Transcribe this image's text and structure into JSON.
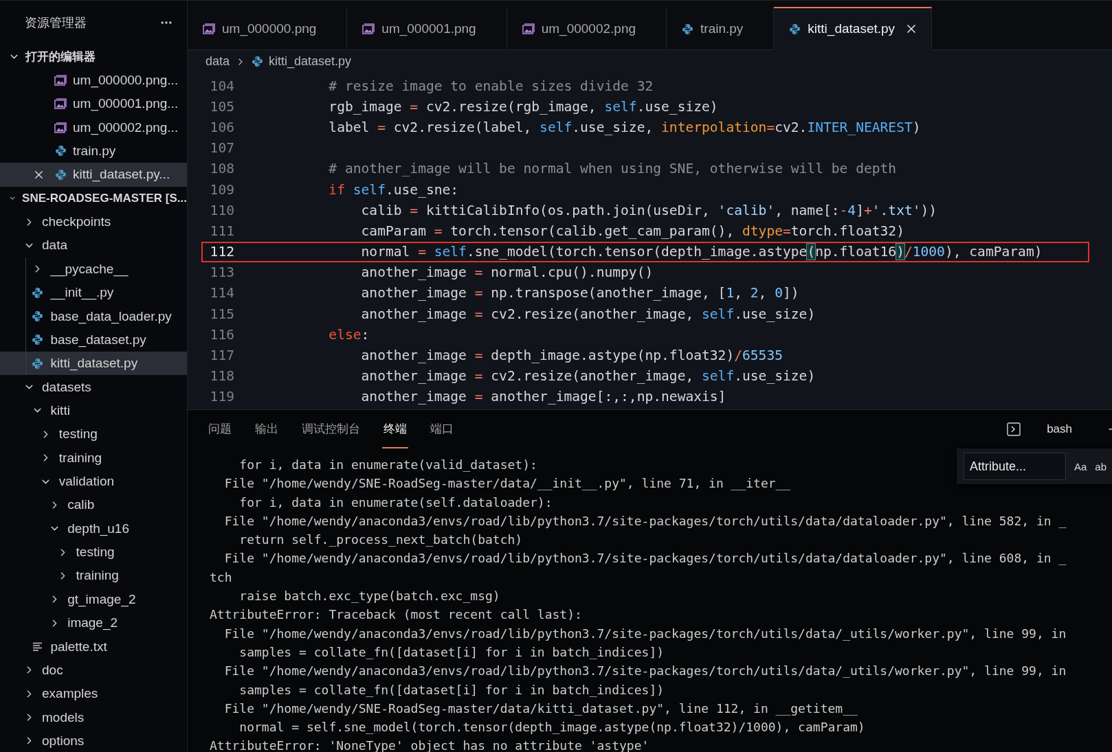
{
  "sidebar": {
    "title": "资源管理器",
    "open_editors": {
      "title": "打开的编辑器",
      "expanded": true,
      "items": [
        {
          "name": "um_000000.png...",
          "kind": "image",
          "selected": false
        },
        {
          "name": "um_000001.png...",
          "kind": "image",
          "selected": false
        },
        {
          "name": "um_000002.png...",
          "kind": "image",
          "selected": false
        },
        {
          "name": "train.py",
          "kind": "python",
          "selected": false
        },
        {
          "name": "kitti_dataset.py...",
          "kind": "python",
          "selected": true
        }
      ]
    },
    "project": {
      "title": "SNE-ROADSEG-MASTER [S...",
      "expanded": true,
      "tree": [
        {
          "label": "checkpoints",
          "kind": "folder",
          "expanded": false,
          "selected": false
        },
        {
          "label": "data",
          "kind": "folder",
          "expanded": true,
          "selected": false,
          "children": [
            {
              "label": "__pycache__",
              "kind": "folder",
              "expanded": false,
              "selected": false
            },
            {
              "label": "__init__.py",
              "kind": "python",
              "selected": false
            },
            {
              "label": "base_data_loader.py",
              "kind": "python",
              "selected": false
            },
            {
              "label": "base_dataset.py",
              "kind": "python",
              "selected": false
            },
            {
              "label": "kitti_dataset.py",
              "kind": "python",
              "selected": true
            }
          ]
        },
        {
          "label": "datasets",
          "kind": "folder",
          "expanded": true,
          "selected": false,
          "children": [
            {
              "label": "kitti",
              "kind": "folder",
              "expanded": true,
              "selected": false,
              "children": [
                {
                  "label": "testing",
                  "kind": "folder",
                  "expanded": false,
                  "selected": false
                },
                {
                  "label": "training",
                  "kind": "folder",
                  "expanded": false,
                  "selected": false
                },
                {
                  "label": "validation",
                  "kind": "folder",
                  "expanded": true,
                  "selected": false,
                  "children": [
                    {
                      "label": "calib",
                      "kind": "folder",
                      "expanded": false,
                      "selected": false
                    },
                    {
                      "label": "depth_u16",
                      "kind": "folder",
                      "expanded": true,
                      "selected": false,
                      "children": [
                        {
                          "label": "testing",
                          "kind": "folder",
                          "expanded": false,
                          "selected": false
                        },
                        {
                          "label": "training",
                          "kind": "folder",
                          "expanded": false,
                          "selected": false
                        }
                      ]
                    },
                    {
                      "label": "gt_image_2",
                      "kind": "folder",
                      "expanded": false,
                      "selected": false
                    },
                    {
                      "label": "image_2",
                      "kind": "folder",
                      "expanded": false,
                      "selected": false
                    }
                  ]
                }
              ]
            },
            {
              "label": "palette.txt",
              "kind": "text",
              "selected": false
            }
          ]
        },
        {
          "label": "doc",
          "kind": "folder",
          "expanded": false,
          "selected": false
        },
        {
          "label": "examples",
          "kind": "folder",
          "expanded": false,
          "selected": false
        },
        {
          "label": "models",
          "kind": "folder",
          "expanded": false,
          "selected": false
        },
        {
          "label": "options",
          "kind": "folder",
          "expanded": false,
          "selected": false
        }
      ]
    }
  },
  "tabs": [
    {
      "label": "um_000000.png",
      "kind": "image",
      "selected": false
    },
    {
      "label": "um_000001.png",
      "kind": "image",
      "selected": false
    },
    {
      "label": "um_000002.png",
      "kind": "image",
      "selected": false
    },
    {
      "label": "train.py",
      "kind": "python",
      "selected": false
    },
    {
      "label": "kitti_dataset.py",
      "kind": "python",
      "selected": true
    }
  ],
  "breadcrumb": [
    {
      "label": "data",
      "kind": "folder"
    },
    {
      "label": "kitti_dataset.py",
      "kind": "python"
    }
  ],
  "editor": {
    "lines": [
      {
        "number": "104",
        "current": false,
        "tokens": [
          {
            "kind": "comment",
            "text": "        # resize image to enable sizes divide 32"
          }
        ]
      },
      {
        "number": "105",
        "current": false,
        "tokens": [
          {
            "kind": "plain",
            "text": "        rgb_image "
          },
          {
            "kind": "op",
            "text": "="
          },
          {
            "kind": "plain",
            "text": " cv2.resize(rgb_image, "
          },
          {
            "kind": "self",
            "text": "self"
          },
          {
            "kind": "plain",
            "text": ".use_size)"
          }
        ]
      },
      {
        "number": "106",
        "current": false,
        "tokens": [
          {
            "kind": "plain",
            "text": "        label "
          },
          {
            "kind": "op",
            "text": "="
          },
          {
            "kind": "plain",
            "text": " cv2.resize(label, "
          },
          {
            "kind": "self",
            "text": "self"
          },
          {
            "kind": "plain",
            "text": ".use_size, "
          },
          {
            "kind": "kwarg",
            "text": "interpolation"
          },
          {
            "kind": "op",
            "text": "="
          },
          {
            "kind": "plain",
            "text": "cv2."
          },
          {
            "kind": "const",
            "text": "INTER_NEAREST"
          },
          {
            "kind": "plain",
            "text": ")"
          }
        ]
      },
      {
        "number": "107",
        "current": false
      },
      {
        "number": "108",
        "current": false,
        "tokens": [
          {
            "kind": "comment",
            "text": "        # another_image will be normal when using SNE, otherwise will be depth"
          }
        ]
      },
      {
        "number": "109",
        "current": false,
        "tokens": [
          {
            "kind": "keyword",
            "text": "        if"
          },
          {
            "kind": "self",
            "text": " self"
          },
          {
            "kind": "plain",
            "text": ".use_sne:"
          }
        ]
      },
      {
        "number": "110",
        "current": false,
        "tokens": [
          {
            "kind": "plain",
            "text": "            calib "
          },
          {
            "kind": "op",
            "text": "="
          },
          {
            "kind": "plain",
            "text": " kittiCalibInfo(os.path.join(useDir, "
          },
          {
            "kind": "string",
            "text": "'calib'"
          },
          {
            "kind": "plain",
            "text": ", name[:"
          },
          {
            "kind": "op",
            "text": "-"
          },
          {
            "kind": "number",
            "text": "4"
          },
          {
            "kind": "plain",
            "text": "]"
          },
          {
            "kind": "op",
            "text": "+"
          },
          {
            "kind": "string",
            "text": "'.txt'"
          },
          {
            "kind": "plain",
            "text": "))"
          }
        ]
      },
      {
        "number": "111",
        "current": false,
        "tokens": [
          {
            "kind": "plain",
            "text": "            camParam "
          },
          {
            "kind": "op",
            "text": "="
          },
          {
            "kind": "plain",
            "text": " torch.tensor(calib.get_cam_param(), "
          },
          {
            "kind": "kwarg",
            "text": "dtype"
          },
          {
            "kind": "op",
            "text": "="
          },
          {
            "kind": "plain",
            "text": "torch.float32)"
          }
        ]
      },
      {
        "number": "112",
        "current": true,
        "tokens": [
          {
            "kind": "plain",
            "text": "            normal "
          },
          {
            "kind": "op",
            "text": "="
          },
          {
            "kind": "self",
            "text": " self"
          },
          {
            "kind": "plain",
            "text": ".sne_model(torch.tensor(depth_image.astype"
          },
          {
            "kind": "bracket",
            "text": "("
          },
          {
            "kind": "plain",
            "text": "np.float16"
          },
          {
            "kind": "bracket",
            "text": ")"
          },
          {
            "kind": "op",
            "text": "/"
          },
          {
            "kind": "number",
            "text": "1000"
          },
          {
            "kind": "plain",
            "text": "), camParam)"
          }
        ]
      },
      {
        "number": "113",
        "current": false,
        "tokens": [
          {
            "kind": "plain",
            "text": "            another_image "
          },
          {
            "kind": "op",
            "text": "="
          },
          {
            "kind": "plain",
            "text": " normal.cpu().numpy()"
          }
        ]
      },
      {
        "number": "114",
        "current": false,
        "tokens": [
          {
            "kind": "plain",
            "text": "            another_image "
          },
          {
            "kind": "op",
            "text": "="
          },
          {
            "kind": "plain",
            "text": " np.transpose(another_image, ["
          },
          {
            "kind": "number",
            "text": "1"
          },
          {
            "kind": "plain",
            "text": ", "
          },
          {
            "kind": "number",
            "text": "2"
          },
          {
            "kind": "plain",
            "text": ", "
          },
          {
            "kind": "number",
            "text": "0"
          },
          {
            "kind": "plain",
            "text": "])"
          }
        ]
      },
      {
        "number": "115",
        "current": false,
        "tokens": [
          {
            "kind": "plain",
            "text": "            another_image "
          },
          {
            "kind": "op",
            "text": "="
          },
          {
            "kind": "plain",
            "text": " cv2.resize(another_image, "
          },
          {
            "kind": "self",
            "text": "self"
          },
          {
            "kind": "plain",
            "text": ".use_size)"
          }
        ]
      },
      {
        "number": "116",
        "current": false,
        "tokens": [
          {
            "kind": "keyword",
            "text": "        else"
          },
          {
            "kind": "plain",
            "text": ":"
          }
        ]
      },
      {
        "number": "117",
        "current": false,
        "tokens": [
          {
            "kind": "plain",
            "text": "            another_image "
          },
          {
            "kind": "op",
            "text": "="
          },
          {
            "kind": "plain",
            "text": " depth_image.astype(np.float32)"
          },
          {
            "kind": "op",
            "text": "/"
          },
          {
            "kind": "number",
            "text": "65535"
          }
        ]
      },
      {
        "number": "118",
        "current": false,
        "tokens": [
          {
            "kind": "plain",
            "text": "            another_image "
          },
          {
            "kind": "op",
            "text": "="
          },
          {
            "kind": "plain",
            "text": " cv2.resize(another_image, "
          },
          {
            "kind": "self",
            "text": "self"
          },
          {
            "kind": "plain",
            "text": ".use_size)"
          }
        ]
      },
      {
        "number": "119",
        "current": false,
        "tokens": [
          {
            "kind": "plain",
            "text": "            another_image "
          },
          {
            "kind": "op",
            "text": "="
          },
          {
            "kind": "plain",
            "text": " another_image[:,:,np.newaxis]"
          }
        ]
      }
    ]
  },
  "panel": {
    "tabs": [
      {
        "label": "问题",
        "selected": false
      },
      {
        "label": "输出",
        "selected": false
      },
      {
        "label": "调试控制台",
        "selected": false
      },
      {
        "label": "终端",
        "selected": true
      },
      {
        "label": "端口",
        "selected": false
      }
    ],
    "shell": "bash",
    "find": {
      "value": "Attribute...",
      "options": [
        "Aa",
        "ab"
      ]
    },
    "terminal_lines": [
      "    for i, data in enumerate(valid_dataset):",
      "  File \"/home/wendy/SNE-RoadSeg-master/data/__init__.py\", line 71, in __iter__",
      "    for i, data in enumerate(self.dataloader):",
      "  File \"/home/wendy/anaconda3/envs/road/lib/python3.7/site-packages/torch/utils/data/dataloader.py\", line 582, in _",
      "    return self._process_next_batch(batch)",
      "  File \"/home/wendy/anaconda3/envs/road/lib/python3.7/site-packages/torch/utils/data/dataloader.py\", line 608, in _",
      "tch",
      "    raise batch.exc_type(batch.exc_msg)",
      "AttributeError: Traceback (most recent call last):",
      "  File \"/home/wendy/anaconda3/envs/road/lib/python3.7/site-packages/torch/utils/data/_utils/worker.py\", line 99, in",
      "    samples = collate_fn([dataset[i] for i in batch_indices])",
      "  File \"/home/wendy/anaconda3/envs/road/lib/python3.7/site-packages/torch/utils/data/_utils/worker.py\", line 99, in",
      "    samples = collate_fn([dataset[i] for i in batch_indices])",
      "  File \"/home/wendy/SNE-RoadSeg-master/data/kitti_dataset.py\", line 112, in __getitem__",
      "    normal = self.sne_model(torch.tensor(depth_image.astype(np.float32)/1000), camParam)",
      "AttributeError: 'NoneType' object has no attribute 'astype'"
    ]
  }
}
